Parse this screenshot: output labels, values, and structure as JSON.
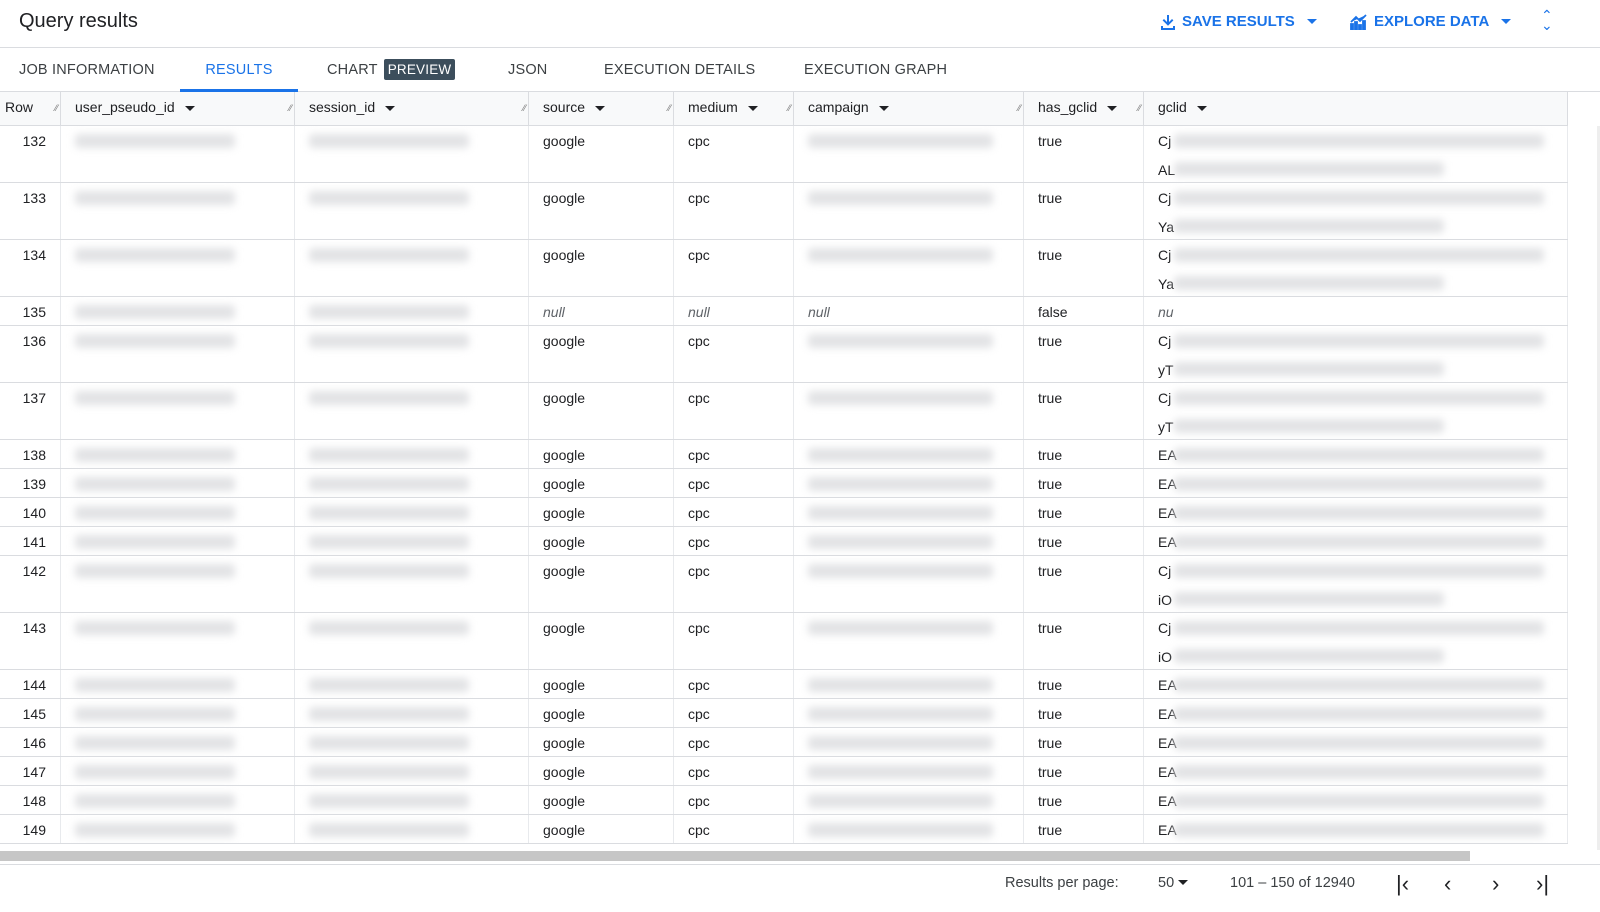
{
  "header": {
    "title": "Query results",
    "save_results": "SAVE RESULTS",
    "explore_data": "EXPLORE DATA"
  },
  "tabs": [
    {
      "label": "JOB INFORMATION"
    },
    {
      "label": "RESULTS",
      "active": true
    },
    {
      "label": "CHART",
      "badge": "PREVIEW"
    },
    {
      "label": "JSON"
    },
    {
      "label": "EXECUTION DETAILS"
    },
    {
      "label": "EXECUTION GRAPH"
    }
  ],
  "columns": [
    "Row",
    "user_pseudo_id",
    "session_id",
    "source",
    "medium",
    "campaign",
    "has_gclid",
    "gclid"
  ],
  "rows": [
    {
      "row": "132",
      "source": "google",
      "medium": "cpc",
      "has_gclid": "true",
      "gclid": "Cj",
      "gclid2": "AL",
      "tall": true
    },
    {
      "row": "133",
      "source": "google",
      "medium": "cpc",
      "has_gclid": "true",
      "gclid": "Cj",
      "gclid2": "Ya",
      "tall": true
    },
    {
      "row": "134",
      "source": "google",
      "medium": "cpc",
      "has_gclid": "true",
      "gclid": "Cj",
      "gclid2": "Ya",
      "tall": true
    },
    {
      "row": "135",
      "source": "null",
      "medium": "null",
      "campaign": "null",
      "has_gclid": "false",
      "gclid": "nu",
      "tall": false
    },
    {
      "row": "136",
      "source": "google",
      "medium": "cpc",
      "has_gclid": "true",
      "gclid": "Cj",
      "gclid2": "yT",
      "tall": true
    },
    {
      "row": "137",
      "source": "google",
      "medium": "cpc",
      "has_gclid": "true",
      "gclid": "Cj",
      "gclid2": "yT",
      "tall": true
    },
    {
      "row": "138",
      "source": "google",
      "medium": "cpc",
      "has_gclid": "true",
      "gclid": "EA",
      "tall": false
    },
    {
      "row": "139",
      "source": "google",
      "medium": "cpc",
      "has_gclid": "true",
      "gclid": "EA",
      "tall": false
    },
    {
      "row": "140",
      "source": "google",
      "medium": "cpc",
      "has_gclid": "true",
      "gclid": "EA",
      "tall": false
    },
    {
      "row": "141",
      "source": "google",
      "medium": "cpc",
      "has_gclid": "true",
      "gclid": "EA",
      "tall": false
    },
    {
      "row": "142",
      "source": "google",
      "medium": "cpc",
      "has_gclid": "true",
      "gclid": "Cj",
      "gclid2": "iO",
      "tall": true
    },
    {
      "row": "143",
      "source": "google",
      "medium": "cpc",
      "has_gclid": "true",
      "gclid": "Cj",
      "gclid2": "iO",
      "tall": true
    },
    {
      "row": "144",
      "source": "google",
      "medium": "cpc",
      "has_gclid": "true",
      "gclid": "EA",
      "tall": false
    },
    {
      "row": "145",
      "source": "google",
      "medium": "cpc",
      "has_gclid": "true",
      "gclid": "EA",
      "tall": false
    },
    {
      "row": "146",
      "source": "google",
      "medium": "cpc",
      "has_gclid": "true",
      "gclid": "EA",
      "tall": false
    },
    {
      "row": "147",
      "source": "google",
      "medium": "cpc",
      "has_gclid": "true",
      "gclid": "EA",
      "tall": false
    },
    {
      "row": "148",
      "source": "google",
      "medium": "cpc",
      "has_gclid": "true",
      "gclid": "EA",
      "tall": false
    },
    {
      "row": "149",
      "source": "google",
      "medium": "cpc",
      "has_gclid": "true",
      "gclid": "EA",
      "tall": false
    }
  ],
  "footer": {
    "per_page_label": "Results per page:",
    "per_page": "50",
    "range": "101 – 150 of 12940"
  },
  "colors": {
    "accent": "#1a73e8",
    "badge": "#3c4e5c"
  }
}
